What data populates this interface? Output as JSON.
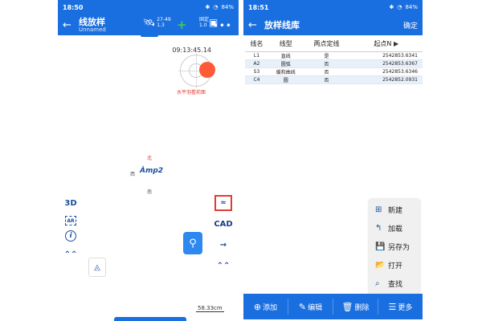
{
  "left": {
    "status": {
      "time": "18:50",
      "battery": "84%"
    },
    "appbar": {
      "title": "线放样",
      "subtitle": "Unnamed",
      "sat_count": "27-49",
      "sat_value": "1.3",
      "fix_label": "固定",
      "fix_value": "1.0"
    },
    "clock": "09:13:45.14",
    "level_warning": "水平泡看前面",
    "compass": {
      "north": "北",
      "south": "南",
      "west": "西",
      "logo": "Ȧmp2"
    },
    "left_tools": [
      "3D",
      "AR",
      "i",
      "⌃⌃"
    ],
    "right_tools": [
      "≈",
      "CAD",
      "→",
      "⌃⌃"
    ],
    "scale": "58.33cm"
  },
  "right": {
    "status": {
      "time": "18:51",
      "battery": "84%"
    },
    "appbar": {
      "title": "放样线库",
      "confirm": "确定"
    },
    "table": {
      "headers": [
        "线名",
        "线型",
        "两点定线",
        "起点N"
      ],
      "rows": [
        [
          "L1",
          "直线",
          "是",
          "2542853.6341"
        ],
        [
          "A2",
          "圆弧",
          "否",
          "2542853.6367"
        ],
        [
          "S3",
          "缓和曲线",
          "否",
          "2542853.6346"
        ],
        [
          "C4",
          "圆",
          "否",
          "2542852.0931"
        ]
      ]
    },
    "menu": [
      {
        "icon": "⊞",
        "label": "新建"
      },
      {
        "icon": "↰",
        "label": "加载"
      },
      {
        "icon": "💾",
        "label": "另存为"
      },
      {
        "icon": "📂",
        "label": "打开"
      },
      {
        "icon": "⌕",
        "label": "查找"
      }
    ],
    "bottombar": [
      {
        "icon": "⊕",
        "label": "添加"
      },
      {
        "icon": "✎",
        "label": "编辑"
      },
      {
        "icon": "🗑",
        "label": "删除"
      },
      {
        "icon": "☰",
        "label": "更多"
      }
    ]
  },
  "colors": {
    "primary": "#1a6fe0",
    "accent_red": "#e53935",
    "bubble": "#ff5a36",
    "fix_green": "#39d04a"
  }
}
